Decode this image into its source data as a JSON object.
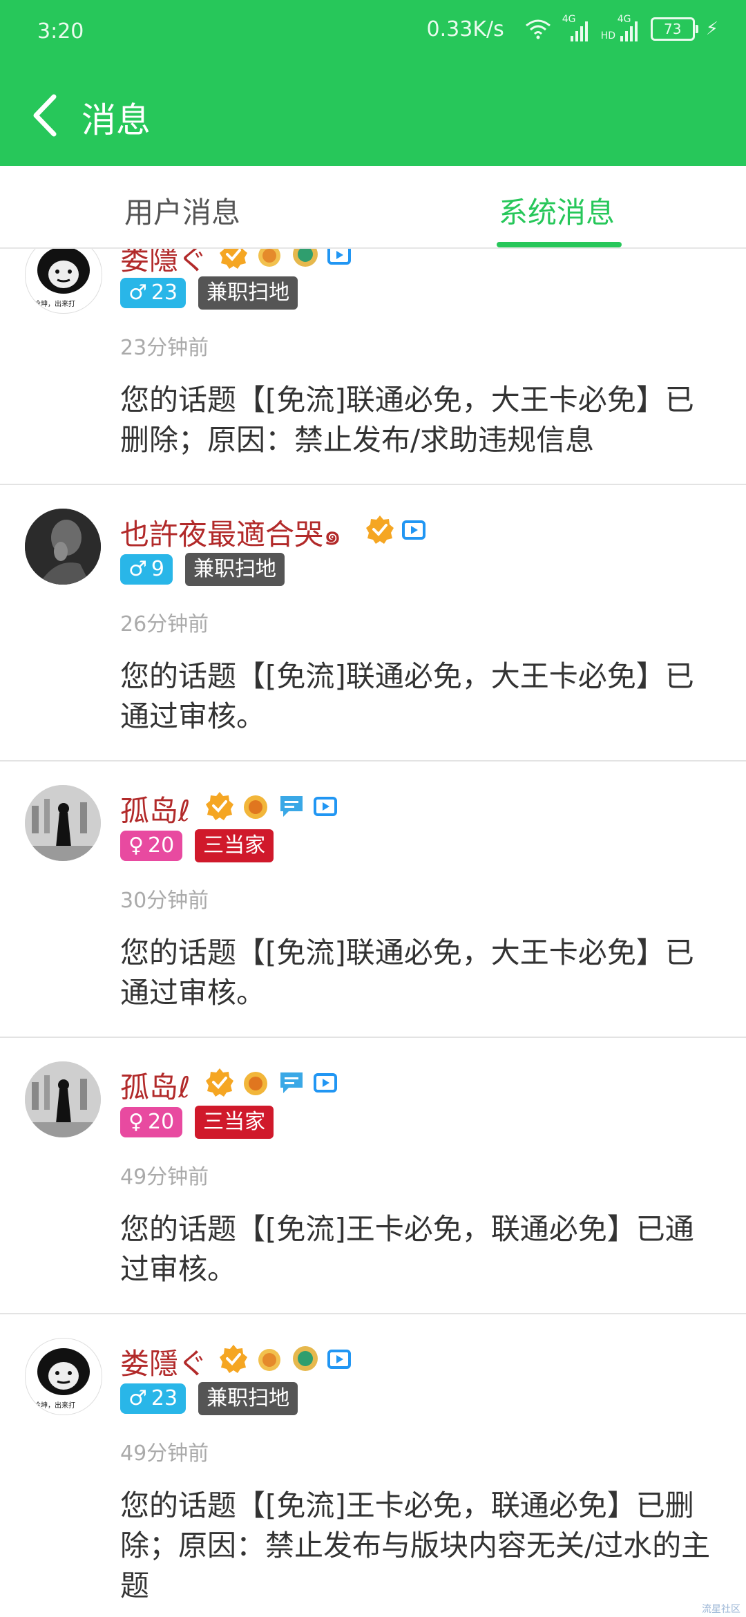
{
  "status": {
    "time": "3:20",
    "speed": "0.33K/s",
    "battery": "73",
    "net1": "4G",
    "net2": "4G",
    "hd": "HD"
  },
  "header": {
    "title": "消息"
  },
  "tabs": {
    "user": "用户消息",
    "system": "系统消息"
  },
  "colors": {
    "accent": "#27c75a",
    "male": "#29b6e8",
    "female": "#e84aa0",
    "tag_grey": "#555555",
    "tag_red": "#d0192b",
    "username": "#b22a2a"
  },
  "messages": [
    {
      "user": "娄隱ぐ",
      "gender": "♂",
      "level": "23",
      "tag": "兼职扫地",
      "time": "23分钟前",
      "text": "您的话题【[免流]联通必免，大王卡必免】已删除；原因：禁止发布/求助违规信息"
    },
    {
      "user": "也許夜最適合哭๑",
      "gender": "♂",
      "level": "9",
      "tag": "兼职扫地",
      "time": "26分钟前",
      "text": "您的话题【[免流]联通必免，大王卡必免】已通过审核。"
    },
    {
      "user": "孤岛ℓ",
      "gender": "♀",
      "level": "20",
      "tag": "三当家",
      "time": "30分钟前",
      "text": "您的话题【[免流]联通必免，大王卡必免】已通过审核。"
    },
    {
      "user": "孤岛ℓ",
      "gender": "♀",
      "level": "20",
      "tag": "三当家",
      "time": "49分钟前",
      "text": "您的话题【[免流]王卡必免，联通必免】已通过审核。"
    },
    {
      "user": "娄隱ぐ",
      "gender": "♂",
      "level": "23",
      "tag": "兼职扫地",
      "time": "49分钟前",
      "text": "您的话题【[免流]王卡必免，联通必免】已删除；原因：禁止发布与版块内容无关/过水的主题"
    }
  ],
  "avatar_caption": "冷坤，出来打",
  "watermark": "流星社区"
}
